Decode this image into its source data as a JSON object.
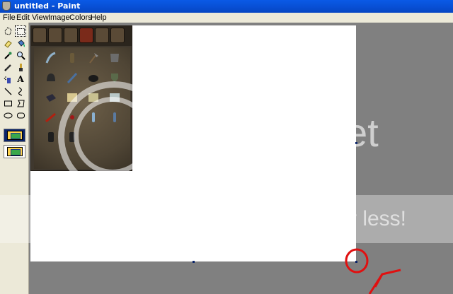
{
  "window": {
    "title": "untitled - Paint"
  },
  "menu": [
    "File",
    "Edit",
    "View",
    "Image",
    "Colors",
    "Help"
  ],
  "tools": [
    {
      "icon": "free-form-select-icon"
    },
    {
      "icon": "rect-select-icon",
      "selected": true
    },
    {
      "icon": "eraser-icon"
    },
    {
      "icon": "fill-bucket-icon"
    },
    {
      "icon": "color-picker-icon"
    },
    {
      "icon": "magnifier-icon"
    },
    {
      "icon": "pencil-icon"
    },
    {
      "icon": "brush-icon"
    },
    {
      "icon": "airbrush-icon"
    },
    {
      "icon": "text-icon",
      "glyph": "A"
    },
    {
      "icon": "line-icon"
    },
    {
      "icon": "curve-icon"
    },
    {
      "icon": "rectangle-icon"
    },
    {
      "icon": "polygon-icon"
    },
    {
      "icon": "ellipse-icon"
    },
    {
      "icon": "rounded-rect-icon"
    }
  ],
  "tool_options": [
    "opaque-selection-option",
    "transparent-selection-option"
  ],
  "watermark": {
    "partial_text_1": "et",
    "partial_text_2": "r less!"
  },
  "colors": {
    "titlebar": "#0a5ae6",
    "workspace": "#808080",
    "annotation": "#e01010"
  }
}
